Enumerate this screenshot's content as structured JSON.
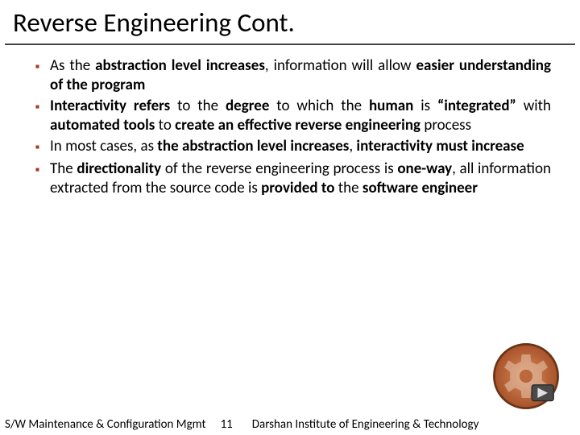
{
  "title": "Reverse Engineering Cont.",
  "bullets": [
    "As the <b>abstraction level increases</b>, information will allow <b>easier understanding of the program</b>",
    "<b>Interactivity refers</b> to the <b>degree</b> to which the <b>human</b> is <b>“integrated”</b> with <b>automated tools</b> to <b>create an effective reverse engineering</b> process",
    "In most cases, as <b>the abstraction level increases</b>, <b>interactivity must increase</b>",
    "The <b>directionality</b> of the reverse engineering process is <b>one-way</b>, all information extracted from the source code is <b>provided to</b> the <b>software engineer</b>"
  ],
  "footer": {
    "left": "S/W Maintenance & Configuration Mgmt",
    "page": "11",
    "right": "Darshan Institute of Engineering & Technology"
  },
  "icon": "gear-play-icon"
}
